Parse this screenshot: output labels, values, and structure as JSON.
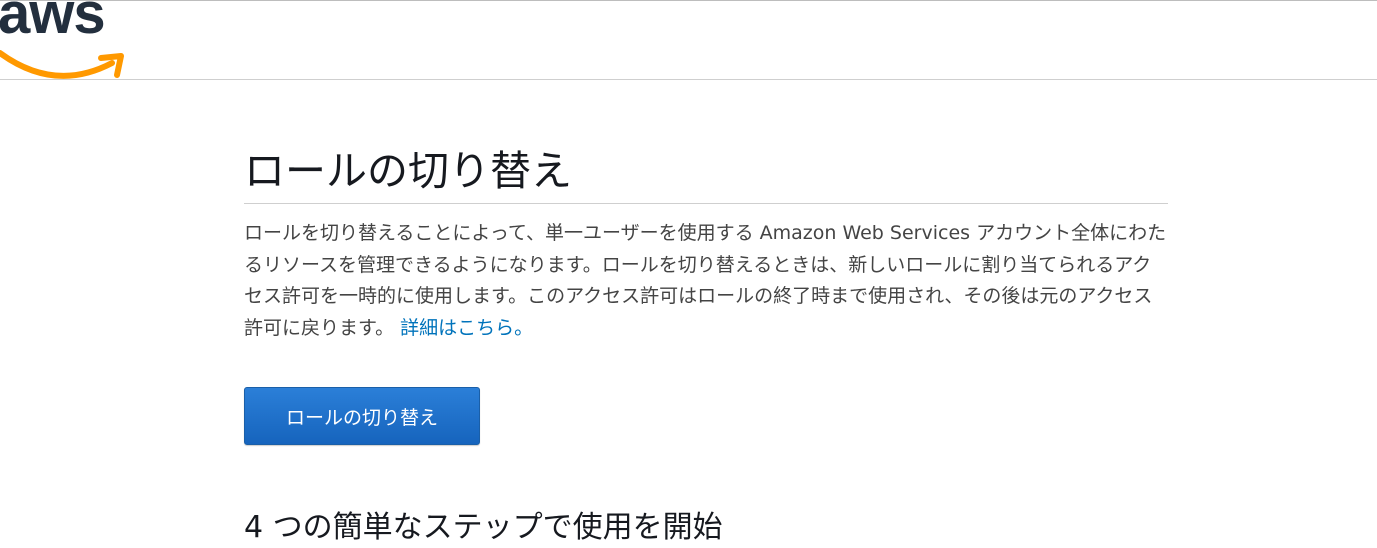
{
  "header": {
    "logo_text": "aws"
  },
  "main": {
    "title": "ロールの切り替え",
    "description": "ロールを切り替えることによって、単一ユーザーを使用する Amazon Web Services アカウント全体にわたるリソースを管理できるようになります。ロールを切り替えるときは、新しいロールに割り当てられるアクセス許可を一時的に使用します。このアクセス許可はロールの終了時まで使用され、その後は元のアクセス許可に戻ります。",
    "learn_more_link": "詳細はこちら。",
    "switch_role_button": "ロールの切り替え",
    "next_section_title": "4 つの簡単なステップで使用を開始"
  },
  "colors": {
    "brand_dark": "#232f3e",
    "brand_orange": "#ff9900",
    "button_blue": "#1f71cb",
    "link_blue": "#0073bb"
  }
}
